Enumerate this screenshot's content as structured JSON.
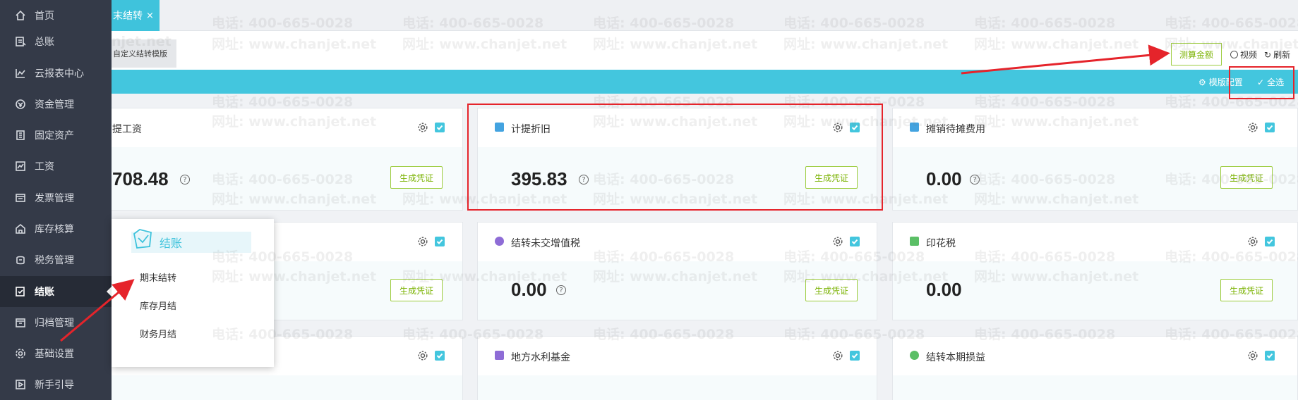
{
  "sidebar": {
    "items": [
      {
        "label": "首页",
        "icon": "home-icon"
      },
      {
        "label": "总账",
        "icon": "ledger-icon"
      },
      {
        "label": "云报表中心",
        "icon": "chart-icon"
      },
      {
        "label": "资金管理",
        "icon": "money-icon"
      },
      {
        "label": "固定资产",
        "icon": "building-icon"
      },
      {
        "label": "工资",
        "icon": "salary-icon"
      },
      {
        "label": "发票管理",
        "icon": "invoice-icon"
      },
      {
        "label": "库存核算",
        "icon": "warehouse-icon"
      },
      {
        "label": "税务管理",
        "icon": "tax-icon"
      },
      {
        "label": "结账",
        "icon": "checkout-icon",
        "active": true
      },
      {
        "label": "归档管理",
        "icon": "archive-icon"
      },
      {
        "label": "基础设置",
        "icon": "gear-icon"
      },
      {
        "label": "新手引导",
        "icon": "play-icon"
      }
    ]
  },
  "tab": {
    "label": "末结转",
    "close": "×"
  },
  "toolbar": {
    "template_label": "自定义结转模版",
    "calc_label": "测算金额",
    "video_label": "视频",
    "refresh_label": "刷新"
  },
  "bar": {
    "template_settings": "模版配置",
    "select_all": "全选"
  },
  "cards": [
    {
      "title": "提工资",
      "amount": "708.48",
      "button": "生成凭证",
      "icon_color": ""
    },
    {
      "title": "计提折旧",
      "amount": "395.83",
      "button": "生成凭证",
      "icon_color": "#43a3e0"
    },
    {
      "title": "摊销待摊费用",
      "amount": "0.00",
      "button": "生成凭证",
      "icon_color": "#43a3e0"
    },
    {
      "title": "",
      "amount": "",
      "button": "生成凭证",
      "icon_color": ""
    },
    {
      "title": "结转未交增值税",
      "amount": "0.00",
      "button": "生成凭证",
      "icon_color": "#8e6cd6"
    },
    {
      "title": "印花税",
      "amount": "0.00",
      "button": "生成凭证",
      "icon_color": "#5bbf66"
    },
    {
      "title": "",
      "amount": "",
      "button": "",
      "icon_color": ""
    },
    {
      "title": "地方水利基金",
      "amount": "",
      "button": "",
      "icon_color": "#8e6cd6"
    },
    {
      "title": "结转本期损益",
      "amount": "",
      "button": "",
      "icon_color": "#5bbf66"
    }
  ],
  "popup": {
    "title": "结账",
    "items": [
      "期末结转",
      "库存月结",
      "财务月结"
    ]
  },
  "watermark": {
    "phone": "电话: 400-665-0028",
    "site": "网址: www.chanjet.net",
    "partial_site": "njet.net"
  },
  "colors": {
    "sidebar": "#343a48",
    "accent": "#43c6de",
    "button_green": "#7cb305",
    "highlight_red": "#e5242b"
  }
}
